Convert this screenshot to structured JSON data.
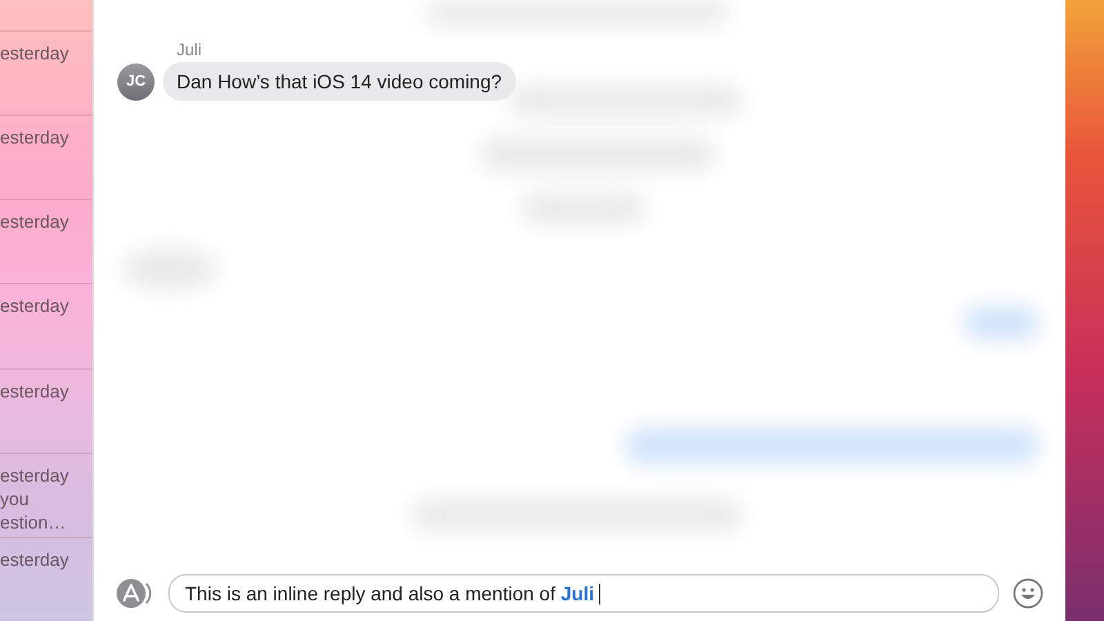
{
  "sidebar": {
    "items": [
      {
        "lines": [
          "esterday"
        ]
      },
      {
        "lines": [
          "esterday"
        ]
      },
      {
        "lines": [
          "esterday"
        ]
      },
      {
        "lines": [
          "esterday"
        ]
      },
      {
        "lines": [
          "esterday"
        ]
      },
      {
        "lines": [
          "esterday",
          "you",
          "estion…"
        ]
      },
      {
        "lines": [
          "esterday"
        ]
      }
    ]
  },
  "message": {
    "sender": "Juli",
    "initials": "JC",
    "text": "Dan How’s that iOS 14 video coming?"
  },
  "composer": {
    "value": "This is an inline reply and also a mention of **Juli**"
  }
}
